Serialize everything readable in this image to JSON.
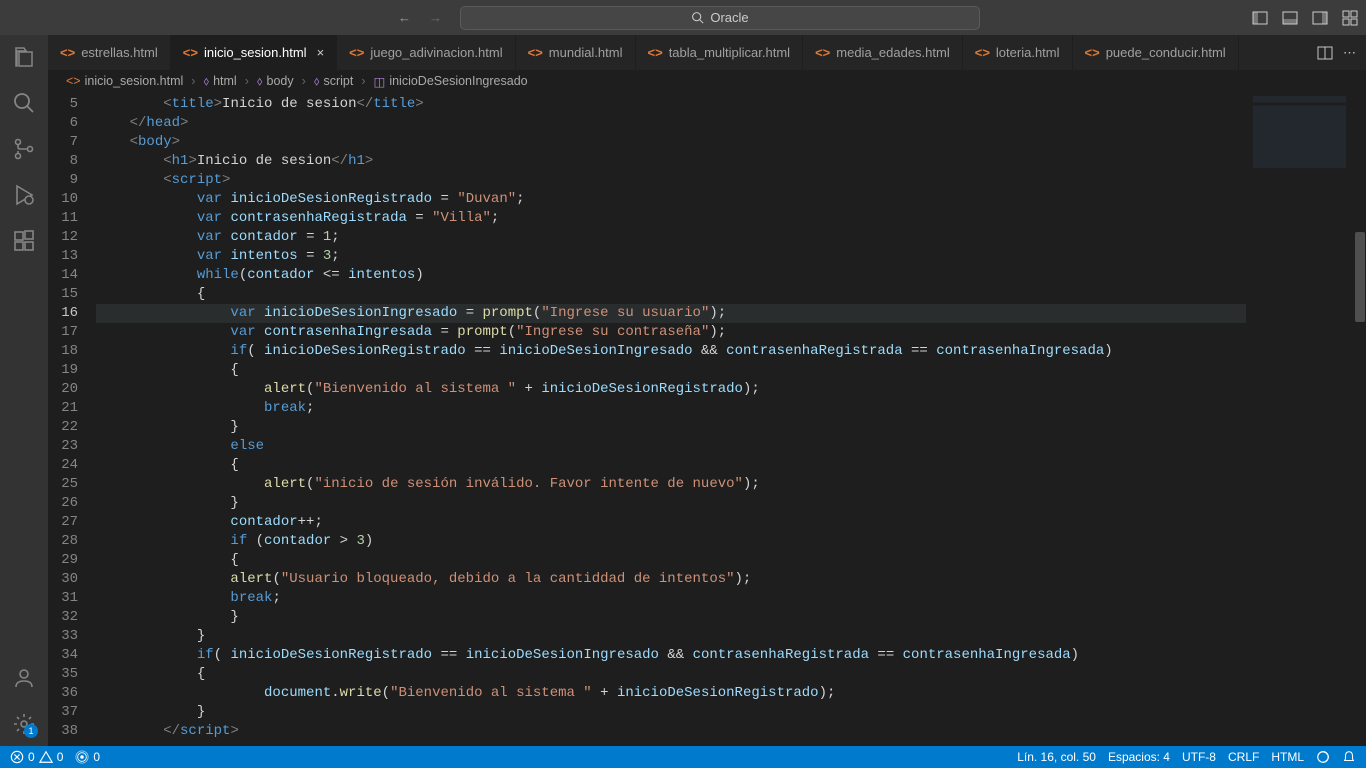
{
  "search": {
    "placeholder": "Oracle"
  },
  "tabs": [
    {
      "label": "estrellas.html",
      "active": false
    },
    {
      "label": "inicio_sesion.html",
      "active": true
    },
    {
      "label": "juego_adivinacion.html",
      "active": false
    },
    {
      "label": "mundial.html",
      "active": false
    },
    {
      "label": "tabla_multiplicar.html",
      "active": false
    },
    {
      "label": "media_edades.html",
      "active": false
    },
    {
      "label": "loteria.html",
      "active": false
    },
    {
      "label": "puede_conducir.html",
      "active": false
    }
  ],
  "breadcrumb": {
    "file": "inicio_sesion.html",
    "parts": [
      "html",
      "body",
      "script",
      "inicioDeSesionIngresado"
    ]
  },
  "gutter": {
    "start": 5,
    "end": 38,
    "current": 16
  },
  "code": {
    "title_text": "Inicio de sesion",
    "h1_text": "Inicio de sesion",
    "var_registrado": "inicioDeSesionRegistrado",
    "val_registrado": "\"Duvan\"",
    "var_contrasenha": "contrasenhaRegistrada",
    "val_contrasenha": "\"Villa\"",
    "var_contador": "contador",
    "val_contador": "1",
    "var_intentos": "intentos",
    "val_intentos": "3",
    "var_ingresado": "inicioDeSesionIngresado",
    "prompt_user": "\"Ingrese su usuario\"",
    "var_contr_ing": "contrasenhaIngresada",
    "prompt_pass": "\"Ingrese su contraseña\"",
    "alert_welcome": "\"Bienvenido al sistema \"",
    "alert_invalid": "\"inicio de sesión inválido. Favor intente de nuevo\"",
    "cond_contador_gt": "3",
    "alert_blocked": "\"Usuario bloqueado, debido a la cantiddad de intentos\"",
    "docwrite_welcome": "\"Bienvenido al sistema \""
  },
  "status": {
    "errors": "0",
    "warnings": "0",
    "port": "0",
    "ln_col": "Lín. 16, col. 50",
    "spaces": "Espacios: 4",
    "encoding": "UTF-8",
    "eol": "CRLF",
    "lang": "HTML"
  },
  "activity_badge": "1"
}
